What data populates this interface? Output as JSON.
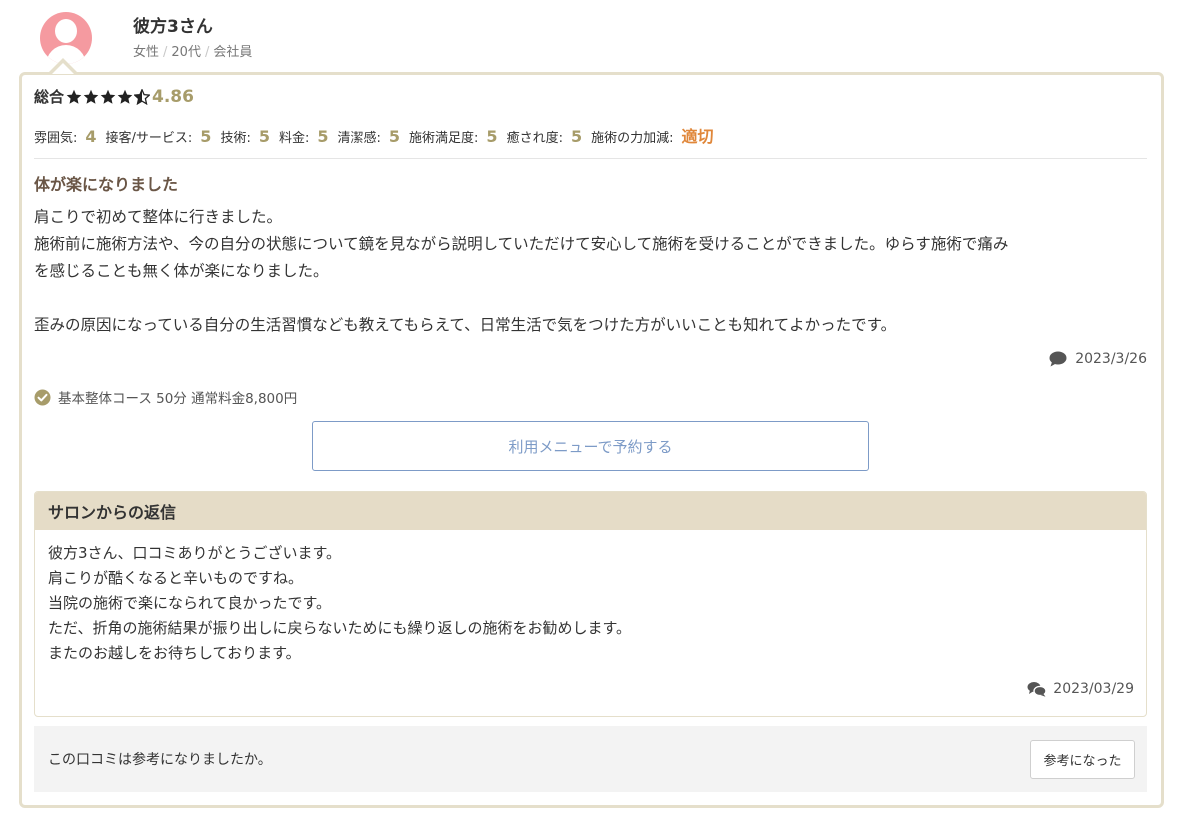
{
  "reviewer": {
    "name": "彼方3さん",
    "gender": "女性",
    "age": "20代",
    "occupation": "会社員",
    "avatar_color": "#f59aa0"
  },
  "rating": {
    "overall_label": "総合",
    "overall_score": "4.86",
    "stars": 4.5,
    "star_color": "#222222",
    "score_color": "#a79c6a",
    "sub_ratings": [
      {
        "label": "雰囲気:",
        "value": "4"
      },
      {
        "label": "接客/サービス:",
        "value": "5"
      },
      {
        "label": "技術:",
        "value": "5"
      },
      {
        "label": "料金:",
        "value": "5"
      },
      {
        "label": "清潔感:",
        "value": "5"
      },
      {
        "label": "施術満足度:",
        "value": "5"
      },
      {
        "label": "癒され度:",
        "value": "5"
      },
      {
        "label": "施術の力加減:",
        "value": "適切"
      }
    ]
  },
  "review": {
    "title": "体が楽になりました",
    "body_lines": [
      "肩こりで初めて整体に行きました。",
      "施術前に施術方法や、今の自分の状態について鏡を見ながら説明していただけて安心して施術を受けることができました。ゆらす施術で痛み",
      "を感じることも無く体が楽になりました。",
      "歪みの原因になっている自分の生活習慣なども教えてもらえて、日常生活で気をつけた方がいいことも知れてよかったです。"
    ],
    "date": "2023/3/26",
    "course": "基本整体コース 50分 通常料金8,800円",
    "book_button": "利用メニューで予約する"
  },
  "reply": {
    "header": "サロンからの返信",
    "body_lines": [
      "彼方3さん、口コミありがとうございます。",
      "肩こりが酷くなると辛いものですね。",
      "当院の施術で楽になられて良かったです。",
      "ただ、折角の施術結果が振り出しに戻らないためにも繰り返しの施術をお勧めします。",
      "またのお越しをお待ちしております。"
    ],
    "date": "2023/03/29"
  },
  "helpful": {
    "question": "この口コミは参考になりましたか。",
    "button": "参考になった"
  },
  "colors": {
    "card_border": "#e5dfcb",
    "reply_header_bg": "#e5dcc7",
    "accent_olive": "#a79c6a",
    "accent_orange": "#e0873a",
    "link_blue": "#7d9bc7",
    "title_brown": "#6a5646"
  },
  "icons": {
    "review_date": "speech-bubble-icon",
    "reply_date": "double-speech-bubble-icon",
    "course": "check-circle-icon"
  }
}
